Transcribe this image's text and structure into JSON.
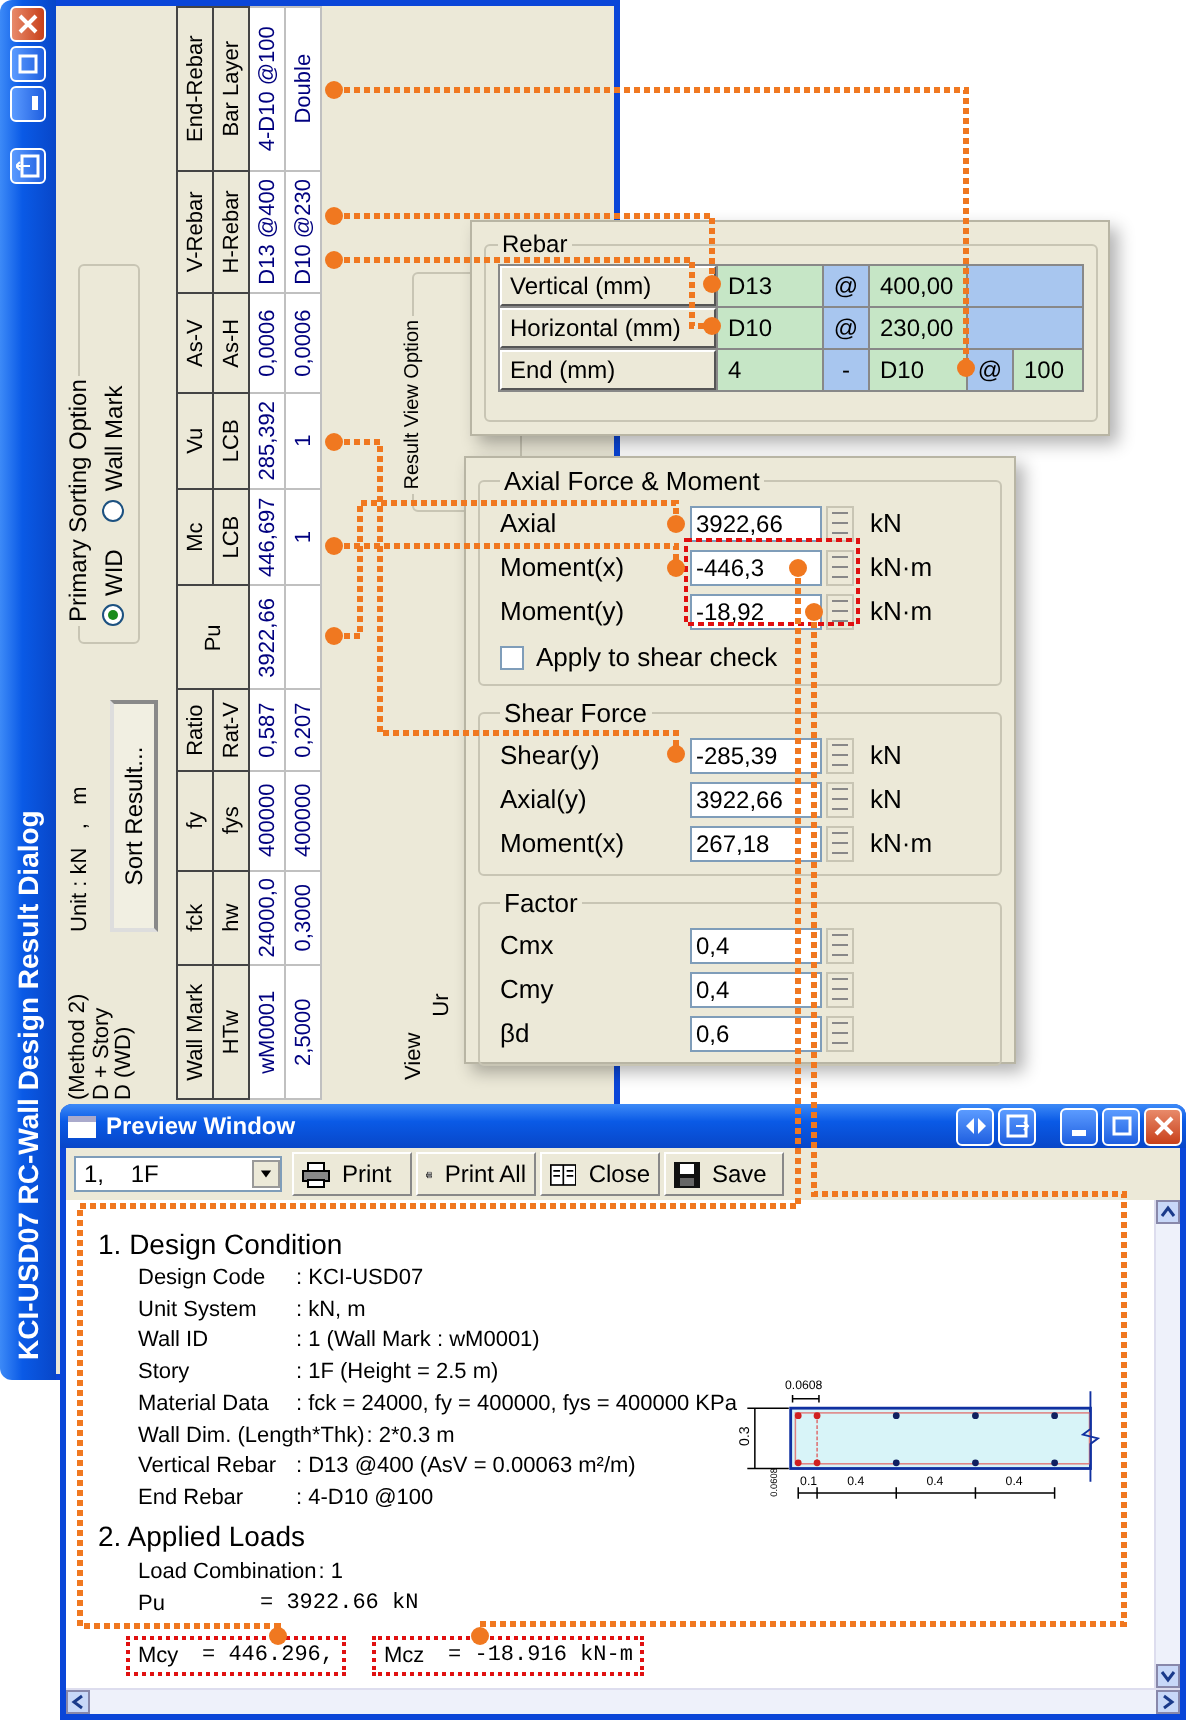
{
  "result_dialog": {
    "title": "KCI-USD07 RC-Wall Design Result Dialog",
    "load_options": [
      "(Method 2)",
      "D + Story",
      "D (WD)"
    ],
    "unit": "Unit : kN   ,   m",
    "sort_button": "Sort Result...",
    "sorting": {
      "title": "Primary Sorting Option",
      "options": [
        {
          "label": "WID",
          "selected": true
        },
        {
          "label": "Wall Mark",
          "selected": false
        }
      ]
    },
    "table": {
      "columns": [
        {
          "top": "Wall Mark",
          "bottom": "HTw",
          "values": [
            "wM0001",
            "2,5000"
          ]
        },
        {
          "top": "fck",
          "bottom": "hw",
          "values": [
            "24000,0",
            "0,3000"
          ]
        },
        {
          "top": "fy",
          "bottom": "fys",
          "values": [
            "400000",
            "400000"
          ]
        },
        {
          "top": "Ratio",
          "bottom": "Rat-V",
          "values": [
            "0,587",
            "0,207"
          ]
        },
        {
          "top": "Pu",
          "values": [
            "3922,66"
          ]
        },
        {
          "top": "Mc",
          "bottom": "LCB",
          "values": [
            "446,697",
            "1"
          ]
        },
        {
          "top": "Vu",
          "bottom": "LCB",
          "values": [
            "285,392",
            "1"
          ]
        },
        {
          "top": "As-V",
          "bottom": "As-H",
          "values": [
            "0,0006",
            "0,0006"
          ]
        },
        {
          "top": "V-Rebar",
          "bottom": "H-Rebar",
          "values": [
            "D13 @400",
            "D10 @230"
          ]
        },
        {
          "top": "End-Rebar",
          "bottom": "Bar Layer",
          "values": [
            "4-D10 @100",
            "Double"
          ]
        }
      ]
    },
    "view_labels": [
      "View",
      "Ur"
    ],
    "result_view_option": "Result View Option"
  },
  "rebar_panel": {
    "title": "Rebar",
    "rows": [
      {
        "label": "Vertical (mm)",
        "cells": [
          {
            "kind": "value",
            "text": "D13"
          },
          {
            "kind": "separator",
            "text": "@"
          },
          {
            "kind": "value",
            "text": "400,00"
          },
          {
            "kind": "blank"
          }
        ]
      },
      {
        "label": "Horizontal (mm)",
        "cells": [
          {
            "kind": "value",
            "text": "D10"
          },
          {
            "kind": "separator",
            "text": "@"
          },
          {
            "kind": "value",
            "text": "230,00"
          },
          {
            "kind": "blank"
          }
        ]
      },
      {
        "label": "End (mm)",
        "cells": [
          {
            "kind": "value",
            "text": "4"
          },
          {
            "kind": "separator",
            "text": "-"
          },
          {
            "kind": "value",
            "text": "D10"
          },
          {
            "kind": "separator",
            "text": "@"
          },
          {
            "kind": "value",
            "text": "100"
          }
        ]
      }
    ]
  },
  "force_panel": {
    "groups": [
      {
        "title": "Axial Force & Moment",
        "rows": [
          {
            "label": "Axial",
            "value": "3922,66",
            "unit": "kN"
          },
          {
            "label": "Moment(x)",
            "value": "-446,3",
            "unit": "kN·m"
          },
          {
            "label": "Moment(y)",
            "value": "-18,92",
            "unit": "kN·m"
          }
        ],
        "checkbox": {
          "label": "Apply to shear check",
          "checked": false
        }
      },
      {
        "title": "Shear Force",
        "rows": [
          {
            "label": "Shear(y)",
            "value": "-285,39",
            "unit": "kN"
          },
          {
            "label": "Axial(y)",
            "value": "3922,66",
            "unit": "kN"
          },
          {
            "label": "Moment(x)",
            "value": "267,18",
            "unit": "kN·m"
          }
        ]
      },
      {
        "title": "Factor",
        "rows": [
          {
            "label": "Cmx",
            "value": "0,4"
          },
          {
            "label": "Cmy",
            "value": "0,4"
          },
          {
            "label": "βd",
            "value": "0,6"
          }
        ]
      }
    ]
  },
  "preview_window": {
    "title": "Preview Window",
    "story_select": "1,    1F",
    "toolbar": [
      {
        "label": "Print"
      },
      {
        "label": "Print All"
      },
      {
        "label": "Close"
      },
      {
        "label": "Save"
      }
    ],
    "design_condition": {
      "heading": "1. Design Condition",
      "rows": [
        {
          "label": "Design Code",
          "value": ": KCI-USD07"
        },
        {
          "label": "Unit System",
          "value": ": kN, m"
        },
        {
          "label": "Wall ID",
          "value": ": 1  (Wall Mark : wM0001)"
        },
        {
          "label": "Story",
          "value": ": 1F  (Height = 2.5 m)"
        },
        {
          "label": "Material Data",
          "value": ": fck = 24000,   fy = 400000,   fys = 400000 KPa"
        },
        {
          "label": "Wall Dim. (Length*Thk)",
          "value": ": 2*0.3 m"
        },
        {
          "label": "Vertical Rebar",
          "value": ": D13 @400 (AsV = 0.00063 m²/m)"
        },
        {
          "label": "End Rebar",
          "value": ": 4-D10 @100"
        }
      ]
    },
    "section_drawing": {
      "top_dimension": "0.0608",
      "height_dimension": "0.3",
      "cover_dimension": "0.0608",
      "spacing_dimensions": [
        "0.1",
        "0.4",
        "0.4",
        "0.4"
      ]
    },
    "applied_loads": {
      "heading": "2. Applied Loads",
      "rows": [
        {
          "label": "Load Combination",
          "value": ": 1"
        },
        {
          "label": "Pu",
          "value": "= 3922.66 kN"
        }
      ],
      "highlighted": [
        {
          "symbol": "Mcy",
          "value": "= 446.296,"
        },
        {
          "symbol": "Mcz",
          "value": "= -18.916 kN-m"
        }
      ]
    }
  }
}
